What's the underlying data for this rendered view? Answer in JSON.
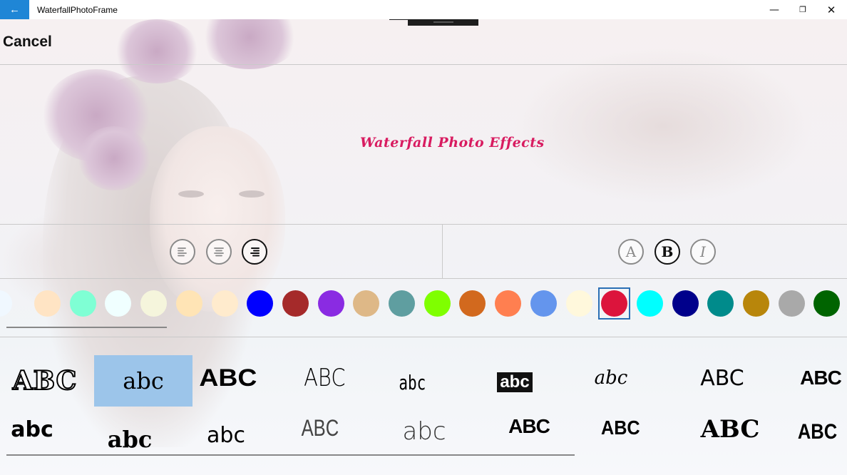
{
  "window": {
    "title": "WaterfallPhotoFrame",
    "back_glyph": "←",
    "minimize_glyph": "—",
    "maximize_glyph": "❐",
    "close_glyph": "✕"
  },
  "header": {
    "cancel_label": "Cancel"
  },
  "preview": {
    "text": "Waterfall Photo Effects",
    "color": "#d81b60"
  },
  "alignment": {
    "options": [
      {
        "name": "align-left-icon",
        "active": false
      },
      {
        "name": "align-center-icon",
        "active": false
      },
      {
        "name": "align-right-icon",
        "active": true
      }
    ]
  },
  "text_style": {
    "options": [
      {
        "name": "normal-style",
        "letter": "A",
        "active": false
      },
      {
        "name": "bold-style",
        "letter": "B",
        "active": true
      },
      {
        "name": "italic-style",
        "letter": "I",
        "active": false
      }
    ]
  },
  "colors": {
    "swatches": [
      "#ffe4c4",
      "#7fffd4",
      "#f0ffff",
      "#f5f5dc",
      "#ffe4b5",
      "#ffebcd",
      "#0000ff",
      "#a52a2a",
      "#8a2be2",
      "#deb887",
      "#5f9ea0",
      "#7fff00",
      "#d2691e",
      "#ff7f50",
      "#6495ed",
      "#fff8dc",
      "#dc143c",
      "#00ffff",
      "#00008b",
      "#008b8b",
      "#b8860b",
      "#a9a9a9",
      "#006400"
    ],
    "selected_index": 16
  },
  "fonts": {
    "row1": [
      "ABC",
      "abc",
      "ABC",
      "ABC",
      "abc",
      "abc",
      "abc",
      "ABC",
      "ABC"
    ],
    "row2": [
      "abc",
      "abc",
      "abc",
      "ABC",
      "abc",
      "ABC",
      "ABC",
      "ABC",
      "ABC"
    ],
    "selected": "row1-1"
  }
}
